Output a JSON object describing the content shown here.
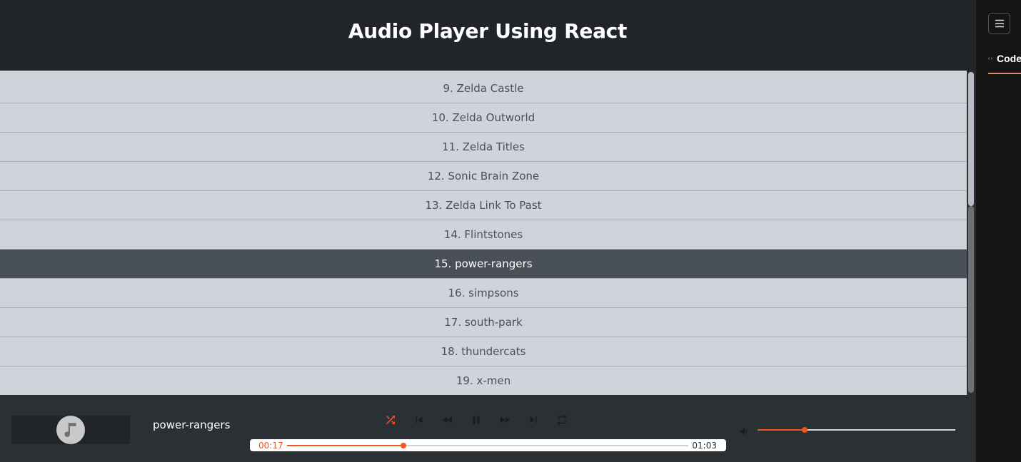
{
  "header": {
    "title": "Audio Player Using React"
  },
  "playlist": {
    "tracks": [
      {
        "label": "9. Zelda Castle"
      },
      {
        "label": "10. Zelda Outworld"
      },
      {
        "label": "11. Zelda Titles"
      },
      {
        "label": "12. Sonic Brain Zone"
      },
      {
        "label": "13. Zelda Link To Past"
      },
      {
        "label": "14. Flintstones"
      },
      {
        "label": "15. power-rangers",
        "active": true
      },
      {
        "label": "16. simpsons"
      },
      {
        "label": "17. south-park"
      },
      {
        "label": "18. thundercats"
      },
      {
        "label": "19. x-men"
      }
    ]
  },
  "player": {
    "now_playing": "power-rangers",
    "cover_icon": "music-note-icon",
    "current_time": "00:17",
    "duration": "01:03",
    "progress_fraction": 0.29,
    "volume_fraction": 0.24,
    "accent_color": "#f0571f",
    "controls": [
      "shuffle-icon",
      "skip-previous-icon",
      "rewind-icon",
      "pause-icon",
      "fast-forward-icon",
      "skip-next-icon",
      "repeat-icon"
    ]
  },
  "side_panel": {
    "menu_icon": "hamburger-icon",
    "tab_icon": "code-icon",
    "tab_label": "Code"
  }
}
